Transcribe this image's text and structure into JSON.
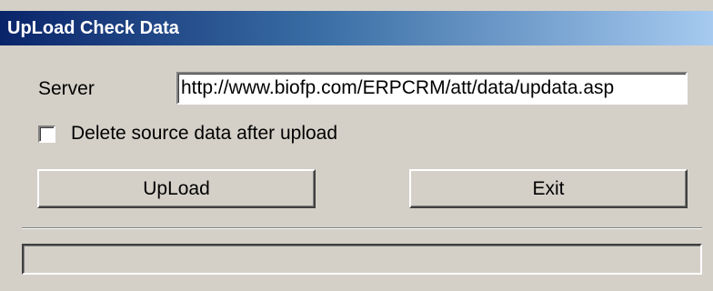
{
  "window": {
    "title": "UpLoad Check Data"
  },
  "server": {
    "label": "Server",
    "value": "http://www.biofp.com/ERPCRM/att/data/updata.asp"
  },
  "delete_option": {
    "label": "Delete source data after upload",
    "checked": false
  },
  "buttons": {
    "upload_label": "UpLoad",
    "exit_label": "Exit"
  },
  "progress": {
    "fraction": 0
  },
  "colors": {
    "title_gradient_start": "#0a246a",
    "title_gradient_end": "#a6caf0",
    "window_face": "#d4d0c8",
    "title_text": "#ffffff"
  }
}
